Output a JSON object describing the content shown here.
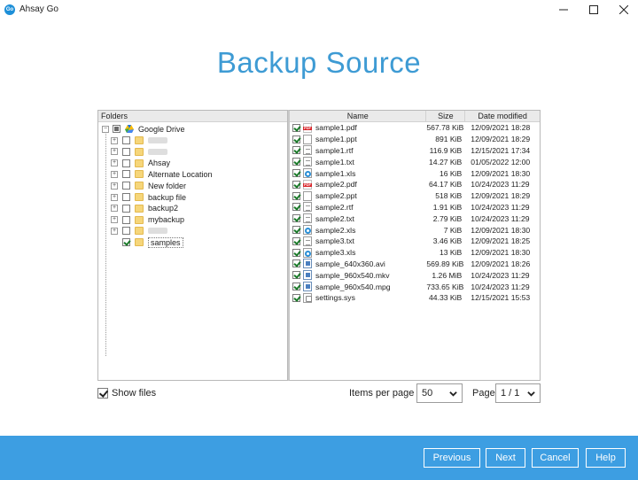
{
  "window": {
    "app_name": "Ahsay Go",
    "logo_text": "Go"
  },
  "page": {
    "title": "Backup Source"
  },
  "folders": {
    "header": "Folders",
    "root": {
      "label": "Google Drive",
      "state": "partial"
    },
    "items": [
      {
        "label": "",
        "blurred": true,
        "state": "unchecked"
      },
      {
        "label": "",
        "blurred": true,
        "state": "unchecked"
      },
      {
        "label": "Ahsay",
        "state": "unchecked"
      },
      {
        "label": "Alternate Location",
        "state": "unchecked"
      },
      {
        "label": "New folder",
        "state": "unchecked"
      },
      {
        "label": "backup file",
        "state": "unchecked"
      },
      {
        "label": "backup2",
        "state": "unchecked"
      },
      {
        "label": "mybackup",
        "state": "unchecked"
      },
      {
        "label": "",
        "blurred": true,
        "state": "unchecked"
      },
      {
        "label": "samples",
        "state": "checked",
        "selected": true
      }
    ]
  },
  "files": {
    "columns": {
      "name": "Name",
      "size": "Size",
      "date": "Date modified"
    },
    "rows": [
      {
        "name": "sample1.pdf",
        "size": "567.78 KiB",
        "date": "12/09/2021 18:28",
        "icon": "pdf"
      },
      {
        "name": "sample1.ppt",
        "size": "891 KiB",
        "date": "12/09/2021 18:29",
        "icon": "doc"
      },
      {
        "name": "sample1.rtf",
        "size": "116.9 KiB",
        "date": "12/15/2021 17:34",
        "icon": "txt"
      },
      {
        "name": "sample1.txt",
        "size": "14.27 KiB",
        "date": "01/05/2022 12:00",
        "icon": "txt"
      },
      {
        "name": "sample1.xls",
        "size": "16 KiB",
        "date": "12/09/2021 18:30",
        "icon": "xls"
      },
      {
        "name": "sample2.pdf",
        "size": "64.17 KiB",
        "date": "10/24/2023 11:29",
        "icon": "pdf"
      },
      {
        "name": "sample2.ppt",
        "size": "518 KiB",
        "date": "12/09/2021 18:29",
        "icon": "doc"
      },
      {
        "name": "sample2.rtf",
        "size": "1.91 KiB",
        "date": "10/24/2023 11:29",
        "icon": "txt"
      },
      {
        "name": "sample2.txt",
        "size": "2.79 KiB",
        "date": "10/24/2023 11:29",
        "icon": "txt"
      },
      {
        "name": "sample2.xls",
        "size": "7 KiB",
        "date": "12/09/2021 18:30",
        "icon": "xls"
      },
      {
        "name": "sample3.txt",
        "size": "3.46 KiB",
        "date": "12/09/2021 18:25",
        "icon": "txt"
      },
      {
        "name": "sample3.xls",
        "size": "13 KiB",
        "date": "12/09/2021 18:30",
        "icon": "xls"
      },
      {
        "name": "sample_640x360.avi",
        "size": "569.89 KiB",
        "date": "12/09/2021 18:26",
        "icon": "vid"
      },
      {
        "name": "sample_960x540.mkv",
        "size": "1.26 MiB",
        "date": "10/24/2023 11:29",
        "icon": "vid"
      },
      {
        "name": "sample_960x540.mpg",
        "size": "733.65 KiB",
        "date": "10/24/2023 11:29",
        "icon": "vid"
      },
      {
        "name": "settings.sys",
        "size": "44.33 KiB",
        "date": "12/15/2021 15:53",
        "icon": "sys"
      }
    ]
  },
  "controls": {
    "show_files_label": "Show files",
    "show_files_checked": true,
    "items_per_page_label": "Items per page",
    "items_per_page_value": "50",
    "page_label": "Page",
    "page_value": "1 / 1"
  },
  "footer": {
    "previous": "Previous",
    "next": "Next",
    "cancel": "Cancel",
    "help": "Help"
  },
  "colors": {
    "accent": "#3d9ee2",
    "title": "#3e9bd4"
  }
}
